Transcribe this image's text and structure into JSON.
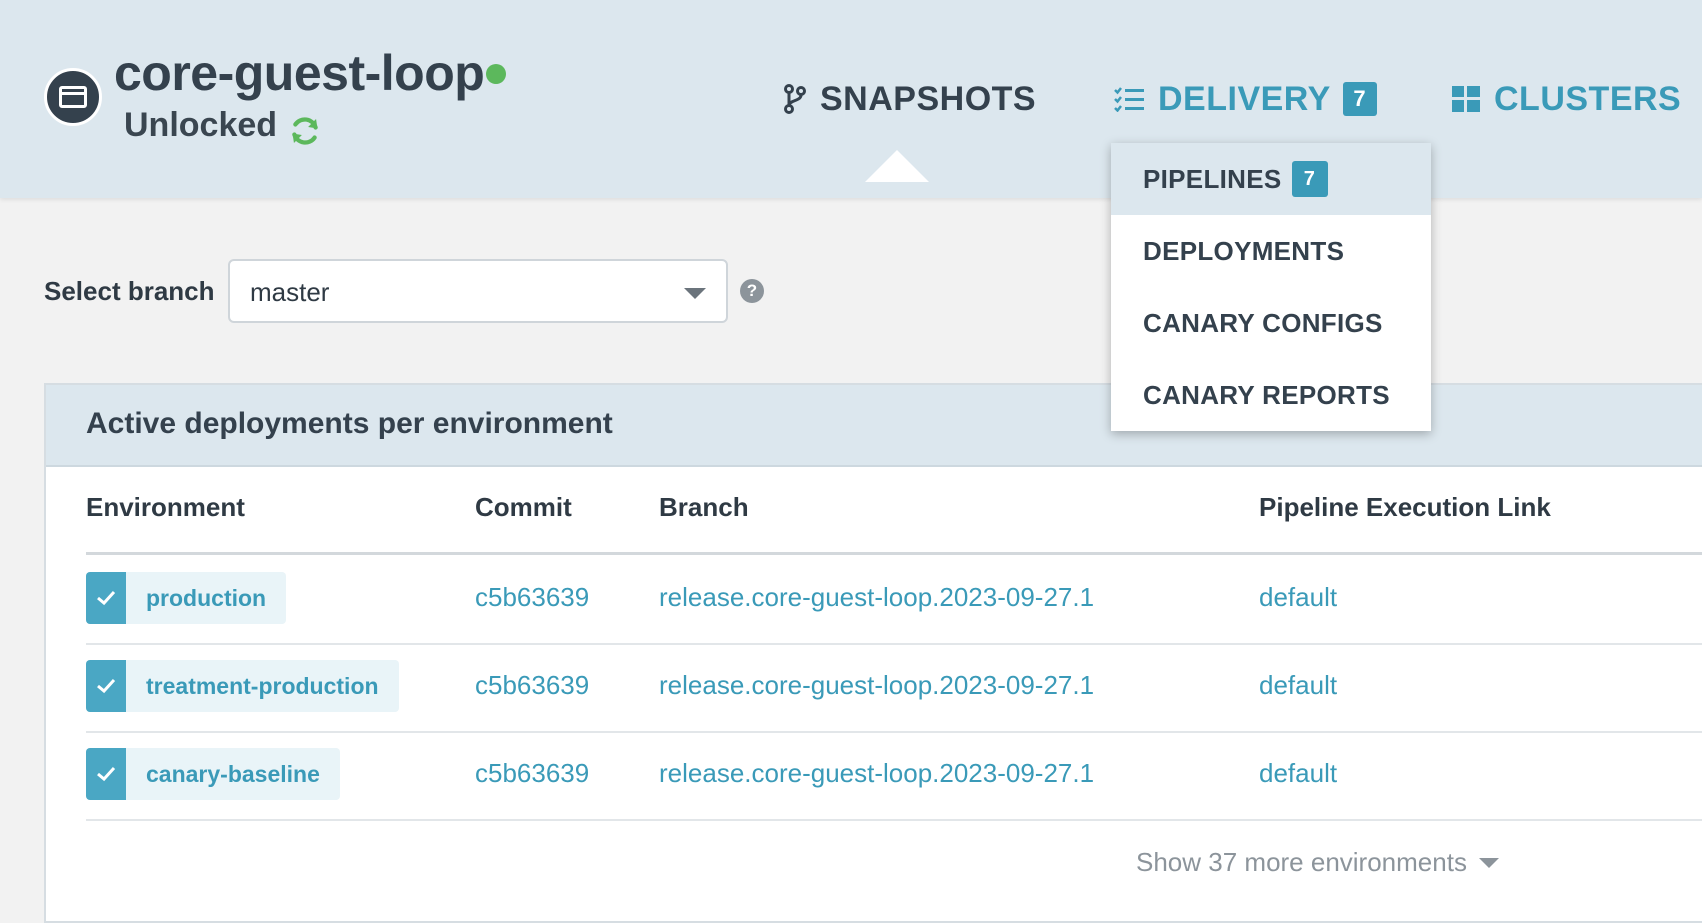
{
  "app": {
    "name": "core-guest-loop",
    "lock_status": "Unlocked",
    "status_color": "#5cb85c",
    "avatar_icon": "window-icon",
    "refresh_icon": "refresh-icon"
  },
  "nav": {
    "snapshots": {
      "label": "SNAPSHOTS",
      "icon": "branch-icon"
    },
    "delivery": {
      "label": "DELIVERY",
      "icon": "checklist-icon",
      "badge": "7"
    },
    "clusters": {
      "label": "CLUSTERS",
      "icon": "grid-icon"
    }
  },
  "delivery_menu": {
    "items": [
      {
        "label": "PIPELINES",
        "badge": "7",
        "active": true
      },
      {
        "label": "DEPLOYMENTS"
      },
      {
        "label": "CANARY CONFIGS"
      },
      {
        "label": "CANARY REPORTS"
      }
    ]
  },
  "branch": {
    "label": "Select branch",
    "value": "master",
    "help": "?"
  },
  "panel": {
    "title": "Active deployments per environment",
    "columns": [
      "Environment",
      "Commit",
      "Branch",
      "Pipeline Execution Link"
    ],
    "rows": [
      {
        "environment": "production",
        "commit": "c5b63639",
        "branch": "release.core-guest-loop.2023-09-27.1",
        "link": "default"
      },
      {
        "environment": "treatment-production",
        "commit": "c5b63639",
        "branch": "release.core-guest-loop.2023-09-27.1",
        "link": "default"
      },
      {
        "environment": "canary-baseline",
        "commit": "c5b63639",
        "branch": "release.core-guest-loop.2023-09-27.1",
        "link": "default"
      }
    ],
    "show_more": "Show 37 more environments"
  },
  "colors": {
    "accent": "#3a9ab8",
    "header_bg": "#dce7ee",
    "text_dark": "#34414d"
  }
}
